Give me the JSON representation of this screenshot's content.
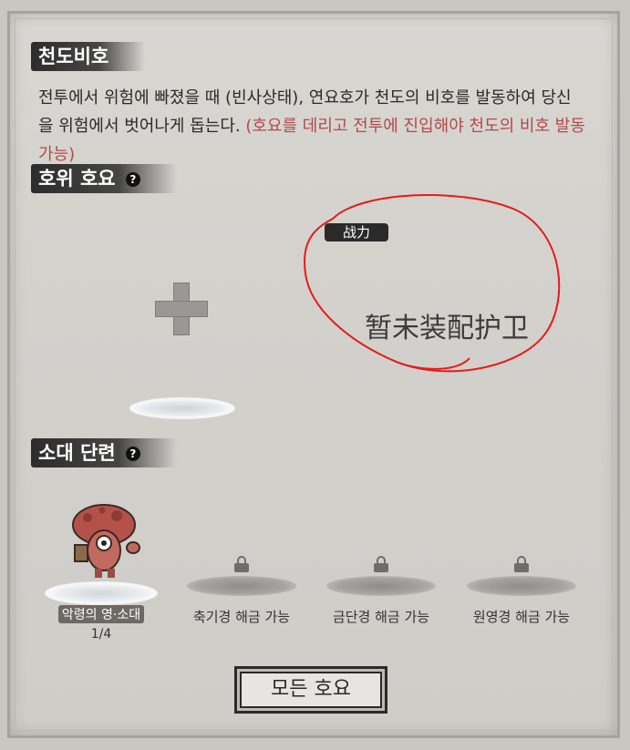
{
  "sections": {
    "protect_title": "천도비호",
    "guard_title": "호위 호요",
    "train_title": "소대 단련"
  },
  "description": {
    "main": "전투에서 위험에 빠졌을 때 (빈사상태), 연요호가 천도의 비호를 발동하여 당신을 위험에서 벗어나게 돕는다.",
    "hint": " (호요를 데리고 전투에 진입해야 천도의 비호 발동 가능)"
  },
  "guard": {
    "power_label": "战力",
    "empty_text": "暂未装配护卫",
    "add_icon": "plus-icon",
    "annotation_color": "#e41b1b"
  },
  "slots": [
    {
      "name": "악령의 영·소대",
      "count": "1/4",
      "locked": false
    },
    {
      "label": "축기경 해금 가능",
      "locked": true
    },
    {
      "label": "금단경 해금 가능",
      "locked": true
    },
    {
      "label": "원영경 해금 가능",
      "locked": true
    }
  ],
  "help_glyph": "?",
  "buttons": {
    "all_label": "모든 호요"
  },
  "colors": {
    "hint_red": "#b14a4a",
    "title_bg": "#2a2a2a"
  }
}
